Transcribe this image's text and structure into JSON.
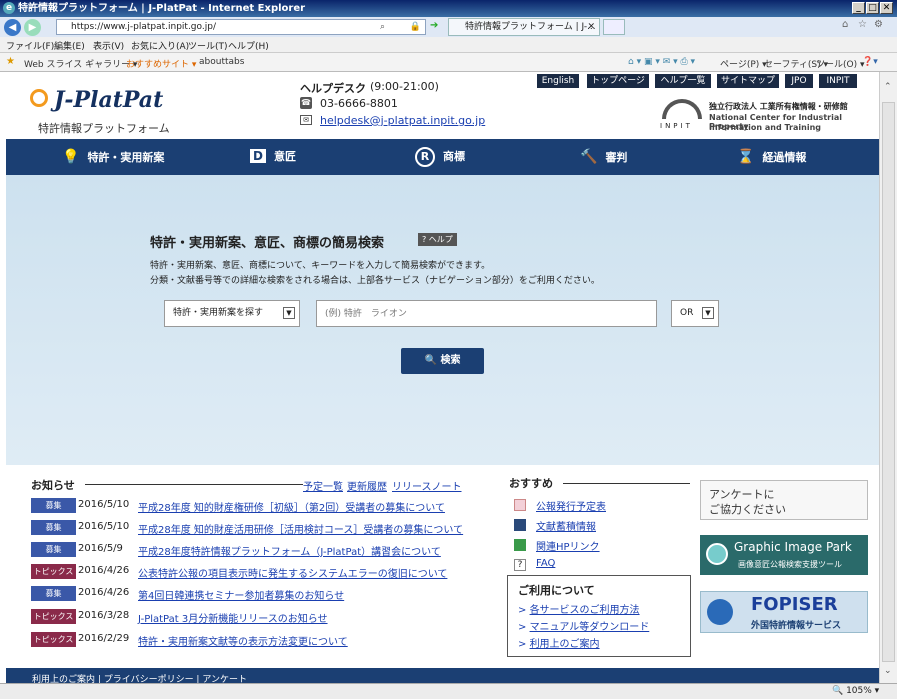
{
  "browser": {
    "title": "特許情報プラットフォーム | J-PlatPat - Internet Explorer",
    "url": "https://www.j-platpat.inpit.go.jp/",
    "tab_label": "特許情報プラットフォーム | J-...",
    "menu": [
      "ファイル(F)",
      "編集(E)",
      "表示(V)",
      "お気に入り(A)",
      "ツール(T)",
      "ヘルプ(H)"
    ],
    "favorites": [
      "Web スライス ギャラリー ▾",
      "おすすめサイト ▾",
      "abouttabs"
    ],
    "command_bar": [
      "ページ(P) ▾",
      "セーフティ(S) ▾",
      "ツール(O) ▾"
    ],
    "zoom": "105%"
  },
  "header": {
    "logo": "J-PlatPat",
    "logo_sub": "特許情報プラットフォーム",
    "helpdesk_label": "ヘルプデスク",
    "helpdesk_hours": "(9:00-21:00)",
    "phone": "03-6666-8801",
    "email": "helpdesk@j-platpat.inpit.go.jp",
    "top_links": [
      "English",
      "トップページ",
      "ヘルプ一覧",
      "サイトマップ",
      "JPO",
      "INPIT"
    ],
    "inpit_ja": "独立行政法人 工業所有権情報・研修館",
    "inpit_en1": "National Center for Industrial Property",
    "inpit_en2": "Information and Training",
    "inpit_logo": "INPIT"
  },
  "nav": {
    "items": [
      {
        "label": "特許・実用新案",
        "icon": "lightbulb-icon"
      },
      {
        "label": "意匠",
        "icon": "design-d-icon"
      },
      {
        "label": "商標",
        "icon": "trademark-r-icon"
      },
      {
        "label": "審判",
        "icon": "gavel-icon"
      },
      {
        "label": "経過情報",
        "icon": "hourglass-icon"
      }
    ]
  },
  "search": {
    "title": "特許・実用新案、意匠、商標の簡易検索",
    "help": "? ヘルプ",
    "desc1": "特許・実用新案、意匠、商標について、キーワードを入力して簡易検索ができます。",
    "desc2": "分類・文献番号等での詳細な検索をされる場合は、上部各サービス（ナビゲーション部分）をご利用ください。",
    "category": "特許・実用新案を探す",
    "placeholder": "(例) 特許　ライオン",
    "operator": "OR",
    "button": "検索"
  },
  "news": {
    "heading": "お知らせ",
    "links": [
      "予定一覧",
      "更新履歴",
      "リリースノート"
    ],
    "items": [
      {
        "tag": "募集",
        "date": "2016/5/10",
        "title": "平成28年度 知的財産権研修［初級］（第2回）受講者の募集について"
      },
      {
        "tag": "募集",
        "date": "2016/5/10",
        "title": "平成28年度 知的財産活用研修［活用検討コース］受講者の募集について"
      },
      {
        "tag": "募集",
        "date": "2016/5/9",
        "title": "平成28年度特許情報プラットフォーム（J-PlatPat）講習会について"
      },
      {
        "tag": "トピックス",
        "date": "2016/4/26",
        "title": "公表特許公報の項目表示時に発生するシステムエラーの復旧について"
      },
      {
        "tag": "募集",
        "date": "2016/4/26",
        "title": "第4回日韓連携セミナー参加者募集のお知らせ"
      },
      {
        "tag": "トピックス",
        "date": "2016/3/28",
        "title": "J-PlatPat 3月分新機能リリースのお知らせ"
      },
      {
        "tag": "トピックス",
        "date": "2016/2/29",
        "title": "特許・実用新案文献等の表示方法変更について"
      }
    ]
  },
  "recommend": {
    "heading": "おすすめ",
    "items": [
      "公報発行予定表",
      "文献蓄積情報",
      "関連HPリンク",
      "FAQ"
    ],
    "usage_heading": "ご利用について",
    "usage_items": [
      "各サービスのご利用方法",
      "マニュアル等ダウンロード",
      "利用上のご案内"
    ]
  },
  "banners": {
    "survey1": "アンケートに",
    "survey2": "ご協力ください",
    "gip1": "Graphic Image Park",
    "gip2": "画像意匠公報検索支援ツール",
    "fopiser1": "FOPISER",
    "fopiser2": "外国特許情報サービス"
  },
  "footer": {
    "text": "利用上のご案内 | プライバシーポリシー | アンケート"
  },
  "colors": {
    "nav": "#1b3f73",
    "tag_recruit": "#3a58a8",
    "tag_topics": "#8a2a4a",
    "link": "#1a3fb0"
  }
}
